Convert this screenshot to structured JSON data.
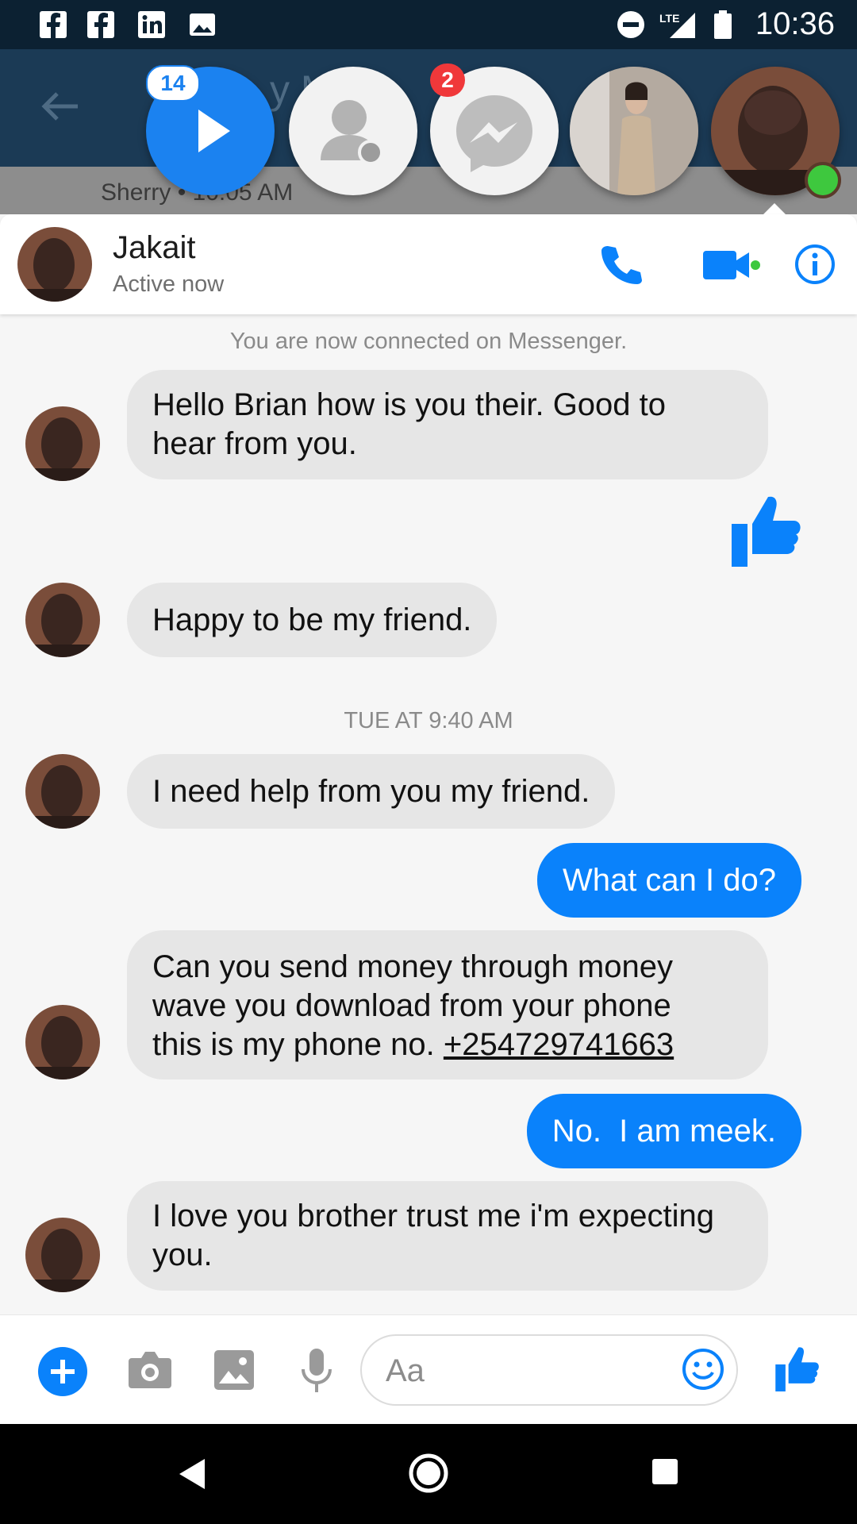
{
  "status_bar": {
    "time": "10:36",
    "network": "LTE"
  },
  "background_app": {
    "title_fragment": "y M    d",
    "sub_fragment": "Sherry • 10:05 AM"
  },
  "chat_heads": {
    "video_badge": "14",
    "messenger_badge": "2"
  },
  "conversation": {
    "contact_name": "Jakait",
    "contact_status": "Active now",
    "connected_notice": "You are now connected on Messenger.",
    "timestamp": "TUE AT 9:40 AM",
    "messages": [
      {
        "from": "them",
        "text_lines": [
          "Hello Brian how is you their. Good to",
          "hear from you."
        ]
      },
      {
        "from": "me",
        "type": "like"
      },
      {
        "from": "them",
        "text": "Happy to be my friend."
      },
      {
        "from": "them",
        "text": "I need help from you my friend."
      },
      {
        "from": "me",
        "text": "What can I do?"
      },
      {
        "from": "them",
        "text_lines": [
          "Can you send money through money",
          "wave you download from your phone",
          "this is my phone no. "
        ],
        "phone": "+254729741663"
      },
      {
        "from": "me",
        "text": "No.  I am meek."
      },
      {
        "from": "them",
        "text_lines": [
          "I love you brother trust me i'm expecting",
          "you."
        ]
      }
    ]
  },
  "composer": {
    "placeholder": "Aa"
  },
  "colors": {
    "accent": "#0a82fb",
    "online": "#3ec83e",
    "badge_red": "#f0383a"
  }
}
